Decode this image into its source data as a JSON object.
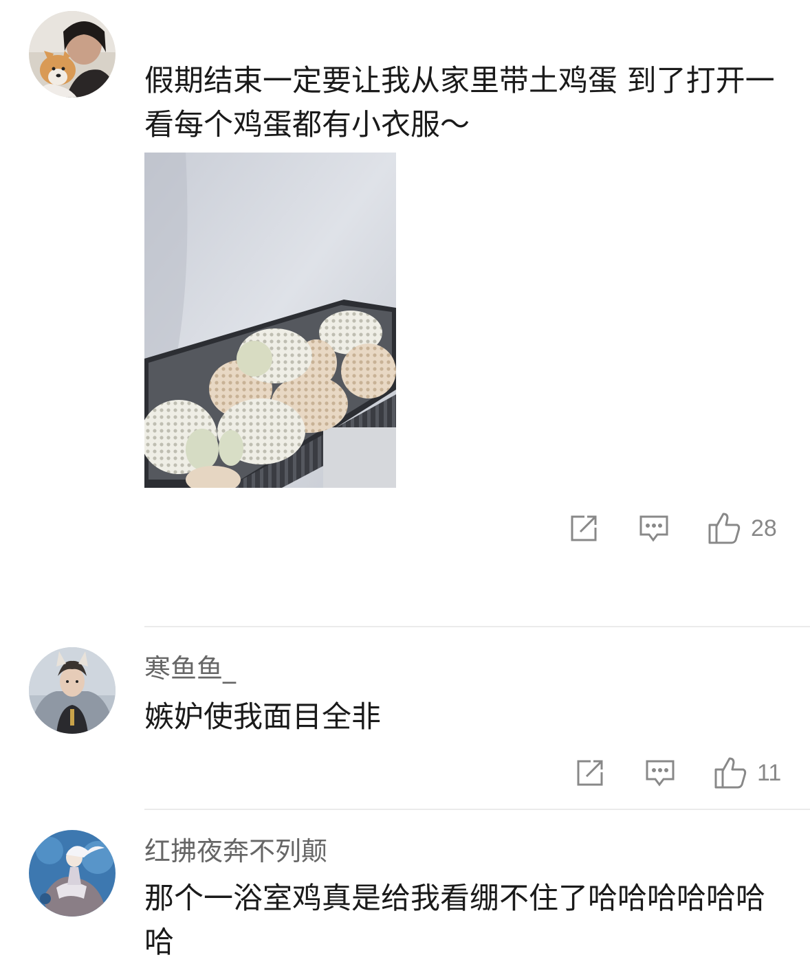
{
  "comments": [
    {
      "username": "",
      "text": "假期结束一定要让我从家里带土鸡蛋 到了打开一看每个鸡蛋都有小衣服～",
      "likes": "28",
      "avatar": "woman-with-dog-avatar",
      "has_image": true,
      "image_desc": "eggs-in-foam-net-sleeves"
    },
    {
      "username": "寒鱼鱼_",
      "text": "嫉妒使我面目全非",
      "likes": "11",
      "avatar": "man-with-animal-ears-avatar"
    },
    {
      "username": "红拂夜奔不列颠",
      "text": "那个一浴室鸡真是给我看绷不住了哈哈哈哈哈哈哈",
      "avatar": "illustrated-figure-avatar"
    }
  ],
  "icons": {
    "share": "share-icon",
    "comment": "comment-icon",
    "like": "thumbs-up-icon"
  },
  "colors": {
    "username": "#666666",
    "text": "#1a1a1a",
    "icon": "#888888",
    "divider": "#ebebeb"
  }
}
